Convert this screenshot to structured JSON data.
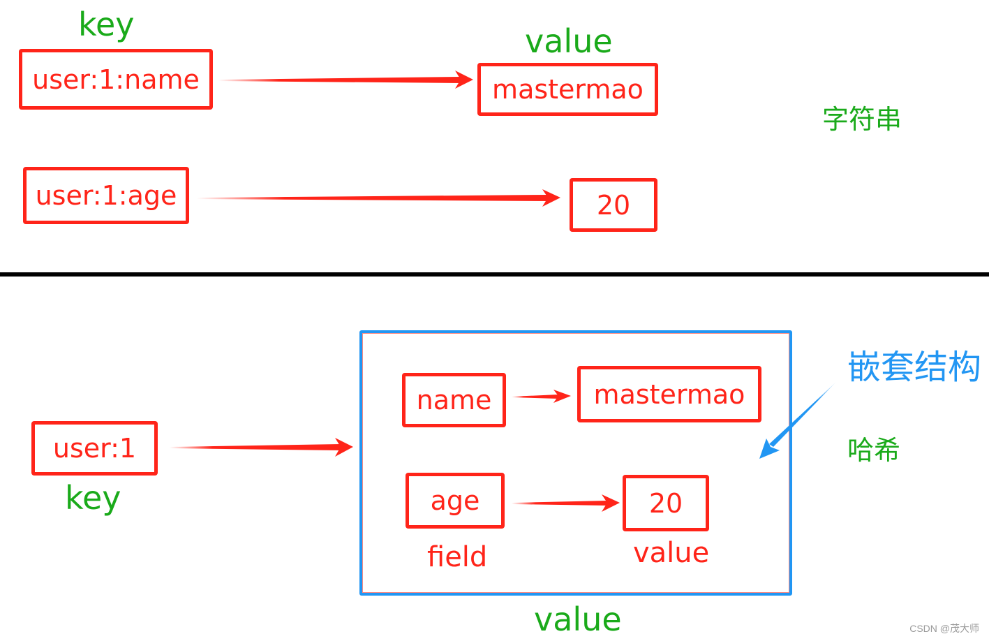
{
  "string_section": {
    "key_label": "key",
    "value_label": "value",
    "type_label": "字符串",
    "entries": [
      {
        "key": "user:1:name",
        "value": "mastermao"
      },
      {
        "key": "user:1:age",
        "value": "20"
      }
    ]
  },
  "hash_section": {
    "key": "user:1",
    "key_label": "key",
    "value_label": "value",
    "field_label": "field",
    "inner_value_label": "value",
    "nested_label": "嵌套结构",
    "type_label": "哈希",
    "fields": [
      {
        "field": "name",
        "value": "mastermao"
      },
      {
        "field": "age",
        "value": "20"
      }
    ]
  },
  "colors": {
    "box_red": "#ff2419",
    "label_green": "#1aaa1a",
    "nested_blue": "#2196f3",
    "divider": "#000000"
  },
  "watermark": "CSDN @茂大师"
}
